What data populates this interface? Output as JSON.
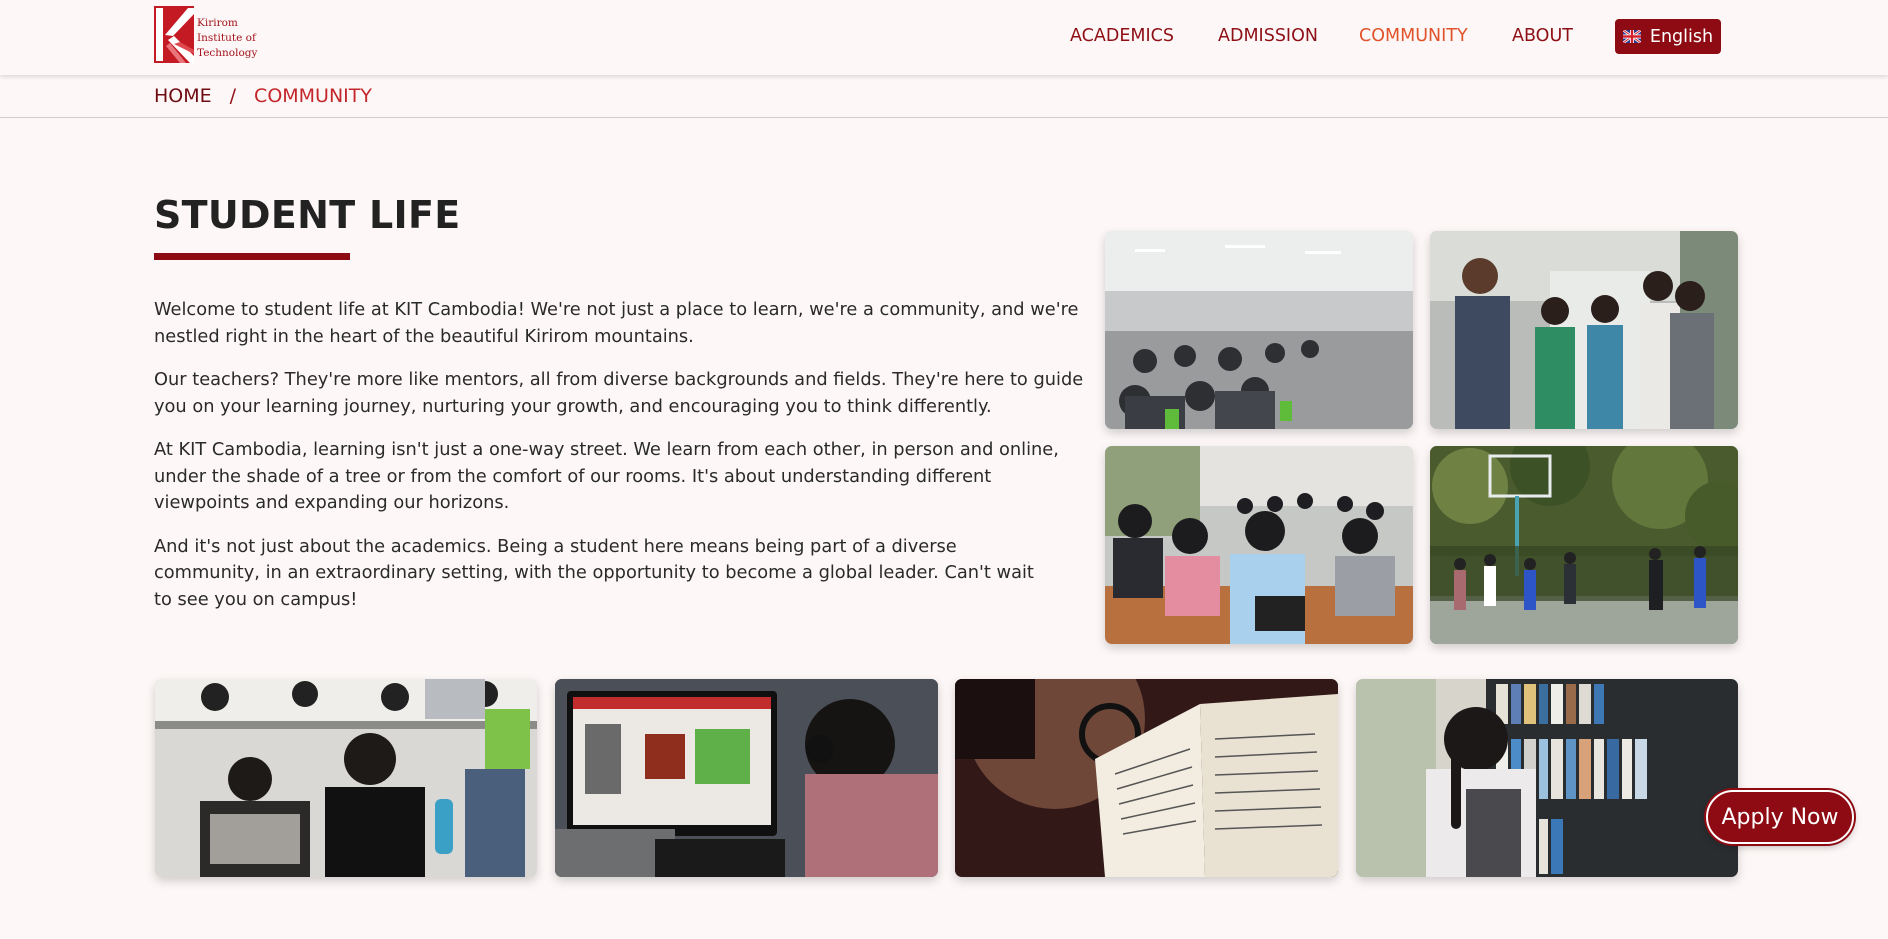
{
  "header": {
    "logo": {
      "name": "logo-icon",
      "lines": [
        "Kirirom",
        "Institute of",
        "Technology"
      ],
      "color": "#a3121b"
    },
    "nav": [
      {
        "label": "ACADEMICS",
        "active": false
      },
      {
        "label": "ADMISSION",
        "active": false
      },
      {
        "label": "COMMUNITY",
        "active": true
      },
      {
        "label": "ABOUT",
        "active": false
      }
    ],
    "language": {
      "label": "English",
      "icon": "uk-flag-icon"
    }
  },
  "breadcrumb": {
    "home": "HOME",
    "separator": "/",
    "current": "COMMUNITY"
  },
  "section": {
    "title": "STUDENT LIFE",
    "paragraphs": [
      "Welcome to student life at KIT Cambodia! We're not just a place to learn, we're a community, and we're nestled right in the heart of the beautiful Kirirom mountains.",
      "Our teachers? They're more like mentors, all from diverse backgrounds and fields. They're here to guide you on your learning journey, nurturing your growth, and encouraging you to think differently.",
      "At KIT Cambodia, learning isn't just a one-way street. We learn from each other, in person and online, under the shade of a tree or from the comfort of our rooms. It's about understanding different viewpoints and expanding our horizons.",
      "And it's not just about the academics. Being a student here means being part of a diverse community, in an extraordinary setting, with the opportunity to become a global leader. Can't wait to see you on campus!"
    ]
  },
  "photos": [
    {
      "name": "lecture-hall-photo"
    },
    {
      "name": "students-talking-photo"
    },
    {
      "name": "classroom-students-photo"
    },
    {
      "name": "basketball-court-photo"
    },
    {
      "name": "study-session-photo"
    },
    {
      "name": "computer-student-photo"
    },
    {
      "name": "reading-book-photo"
    },
    {
      "name": "library-shelf-photo"
    }
  ],
  "apply": {
    "label": "Apply Now"
  },
  "colors": {
    "brand": "#8e0b13",
    "nav_text": "#8e0f16",
    "nav_active": "#e1522b",
    "background": "#fdf8f7"
  }
}
